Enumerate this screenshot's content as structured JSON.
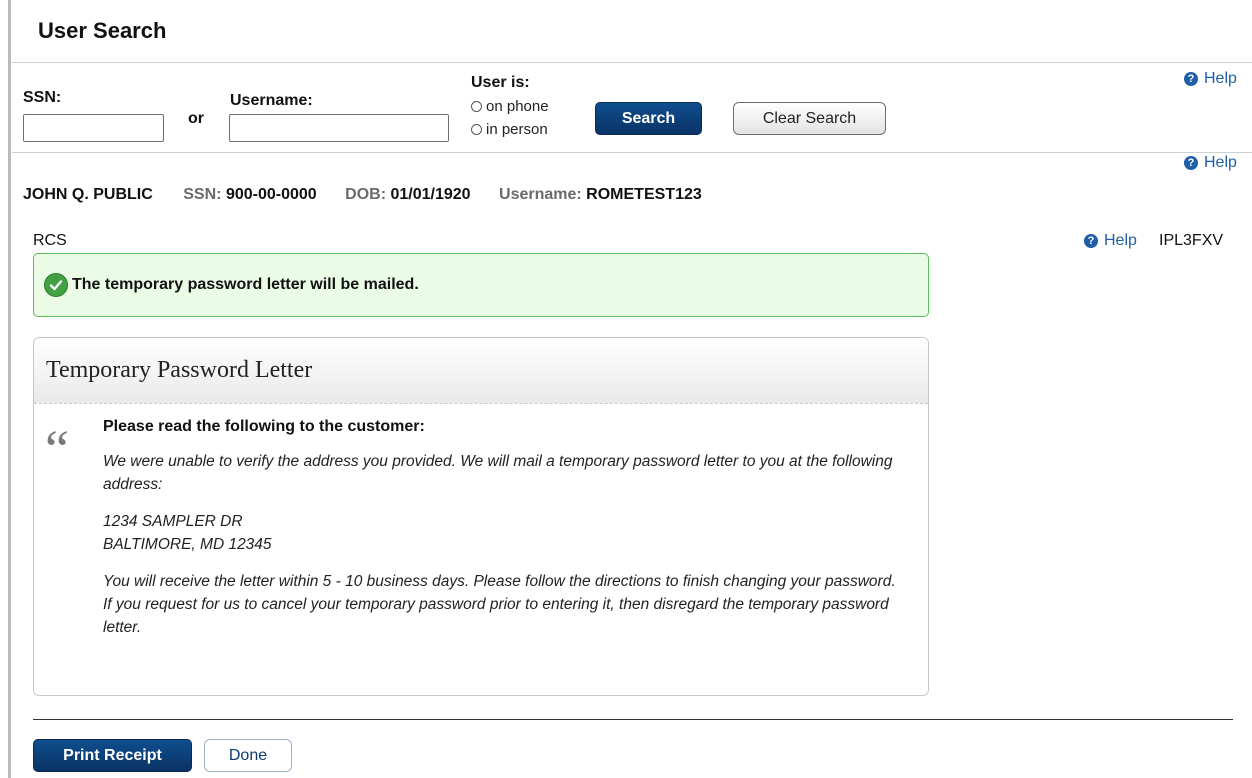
{
  "header": {
    "title": "User Search"
  },
  "search": {
    "ssn_label": "SSN:",
    "or_text": "or",
    "username_label": "Username:",
    "ssn_value": "",
    "username_value": "",
    "user_is_label": "User is:",
    "options": [
      "on phone",
      "in person"
    ],
    "search_button": "Search",
    "clear_button": "Clear Search",
    "help": "Help"
  },
  "user": {
    "name": "JOHN Q. PUBLIC",
    "ssn_label": "SSN:",
    "ssn": "900-00-0000",
    "dob_label": "DOB:",
    "dob": "01/01/1920",
    "username_label": "Username:",
    "username": "ROMETEST123",
    "help": "Help"
  },
  "context": {
    "label": "RCS",
    "help": "Help",
    "code": "IPL3FXV"
  },
  "alert": {
    "message": "The temporary password letter will be mailed."
  },
  "panel": {
    "title": "Temporary Password Letter",
    "instruction": "Please read the following to the customer:",
    "paragraph1": "We were unable to verify the address you provided. We will mail a temporary password letter to you at the following address:",
    "address_line1": "1234 SAMPLER DR",
    "address_line2": "BALTIMORE, MD 12345",
    "paragraph2": "You will receive the letter within 5 - 10 business days. Please follow the directions to finish changing your password. If you request for us to cancel your temporary password prior to entering it, then disregard the temporary password letter."
  },
  "footer": {
    "print_button": "Print Receipt",
    "done_button": "Done"
  },
  "colors": {
    "primary": "#0a3366",
    "help": "#1f5fa8",
    "success_border": "#5cbd5c",
    "success_bg": "#eafbe6"
  }
}
